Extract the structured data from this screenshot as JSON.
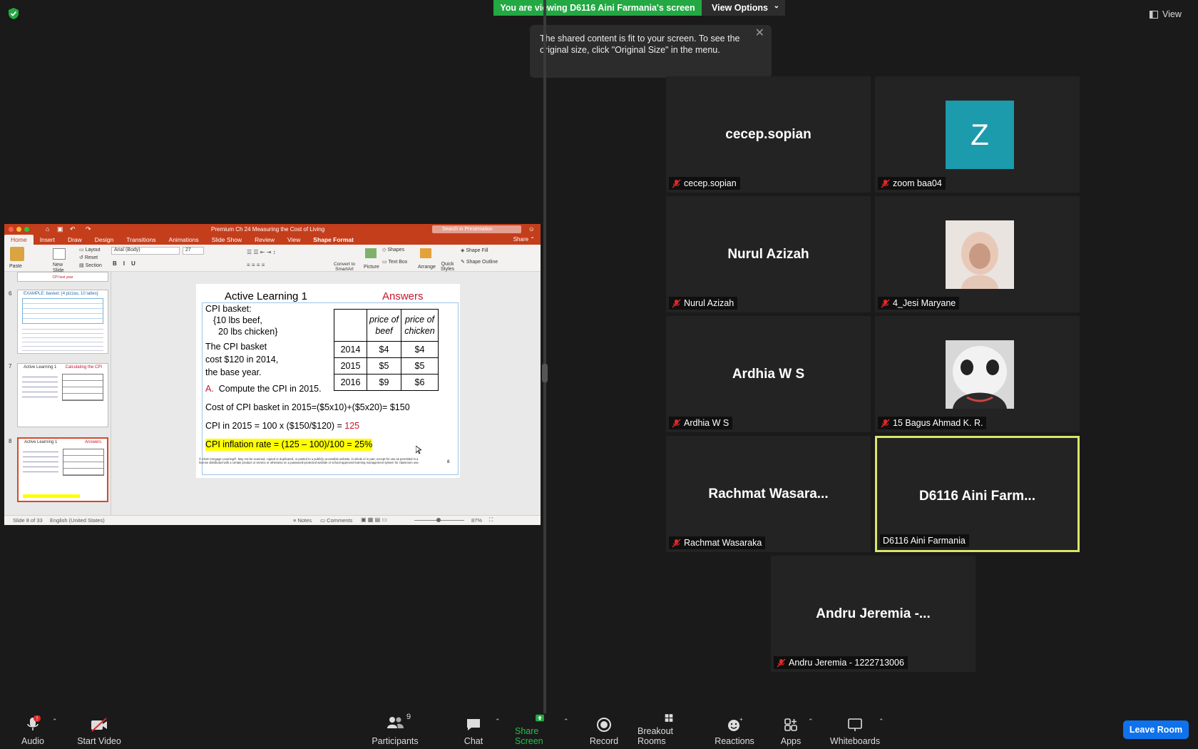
{
  "banner": {
    "viewing_text": "You are viewing D6116 Aini Farmania's screen",
    "view_options": "View Options"
  },
  "tooltip": {
    "text": "The shared content is fit to your screen. To see the original size, click \"Original Size\" in the menu."
  },
  "top_right": {
    "view_label": "View"
  },
  "ppt": {
    "window_title": "Premium Ch 24 Measuring the Cost of Living",
    "search_placeholder": "Search in Presentation",
    "share_label": "Share",
    "tabs": [
      "Home",
      "Insert",
      "Draw",
      "Design",
      "Transitions",
      "Animations",
      "Slide Show",
      "Review",
      "View",
      "Shape Format"
    ],
    "ribbon": {
      "paste": "Paste",
      "new_slide": "New\nSlide",
      "layout": "Layout",
      "reset": "Reset",
      "section": "Section",
      "font": "Arial (Body)",
      "font_size": "27",
      "convert": "Convert to\nSmartArt",
      "picture": "Picture",
      "shapes": "Shapes",
      "text_box": "Text Box",
      "arrange": "Arrange",
      "quick_styles": "Quick\nStyles",
      "shape_fill": "Shape Fill",
      "shape_outline": "Shape Outline"
    },
    "thumbnails": [
      {
        "num": "6",
        "title": "EXAMPLE: basket: {4 pizzas, 10 lattes}"
      },
      {
        "num": "7",
        "title": "Active Learning 1",
        "subtitle": "Calculating the CPI"
      },
      {
        "num": "8",
        "title": "Active Learning 1",
        "subtitle": "Answers"
      }
    ],
    "thumb_top_text": "CPI test year",
    "status": {
      "slide": "Slide 8 of 33",
      "language": "English (United States)",
      "notes": "Notes",
      "comments": "Comments",
      "zoom": "87%"
    }
  },
  "slide": {
    "title": "Active Learning 1",
    "answers": "Answers",
    "basket_lines": [
      "CPI basket:",
      "{10 lbs beef,",
      "20 lbs chicken}",
      "The CPI basket",
      "cost $120 in 2014,",
      "the base year."
    ],
    "table_headers": [
      "",
      "price of beef",
      "price of chicken"
    ],
    "table_rows": [
      [
        "2014",
        "$4",
        "$4"
      ],
      [
        "2015",
        "$5",
        "$5"
      ],
      [
        "2016",
        "$9",
        "$6"
      ]
    ],
    "question_letter": "A.",
    "question": "Compute the CPI in 2015.",
    "cost_line": "Cost of CPI basket in 2015=($5x10)+($5x20)= $150",
    "cpi_prefix": "CPI in 2015 = 100 x ($150/$120) = ",
    "cpi_value": "125",
    "inflation_line": "CPI inflation rate = (125 – 100)/100 = 25%",
    "footer": "© 2018 Cengage Learning®. May not be scanned, copied or duplicated, or posted to a publicly accessible website, in whole or in part, except for use as permitted in a license distributed with a certain product or service or otherwise on a password-protected website or school-approved learning management system for classroom use.",
    "page_num": "8"
  },
  "participants_tiles": [
    {
      "big": "cecep.sopian",
      "name": "cecep.sopian",
      "kind": "text"
    },
    {
      "big": "Z",
      "name": "zoom baa04",
      "kind": "avatar"
    },
    {
      "big": "Nurul Azizah",
      "name": "Nurul Azizah",
      "kind": "text"
    },
    {
      "big": "",
      "name": "4_Jesi Maryane",
      "kind": "photo"
    },
    {
      "big": "Ardhia W S",
      "name": "Ardhia W S",
      "kind": "text"
    },
    {
      "big": "",
      "name": "15 Bagus Ahmad K. R.",
      "kind": "panda"
    },
    {
      "big": "Rachmat Wasara...",
      "name": "Rachmat Wasaraka",
      "kind": "text"
    },
    {
      "big": "D6116 Aini Farm...",
      "name": "D6116 Aini Farmania",
      "kind": "active"
    },
    {
      "big": "Andru Jeremia -...",
      "name": "Andru Jeremia - 1222713006",
      "kind": "text"
    }
  ],
  "toolbar": {
    "audio": "Audio",
    "start_video": "Start Video",
    "participants": "Participants",
    "participants_count": "9",
    "chat": "Chat",
    "share_screen": "Share Screen",
    "record": "Record",
    "breakout": "Breakout Rooms",
    "reactions": "Reactions",
    "apps": "Apps",
    "whiteboards": "Whiteboards",
    "leave": "Leave Room"
  },
  "colors": {
    "banner_green": "#23a843",
    "leave_blue": "#0e72ed",
    "active_speaker": "#d9e66a",
    "ppt_red": "#c43e1c",
    "avatar_teal": "#1b9bab"
  }
}
